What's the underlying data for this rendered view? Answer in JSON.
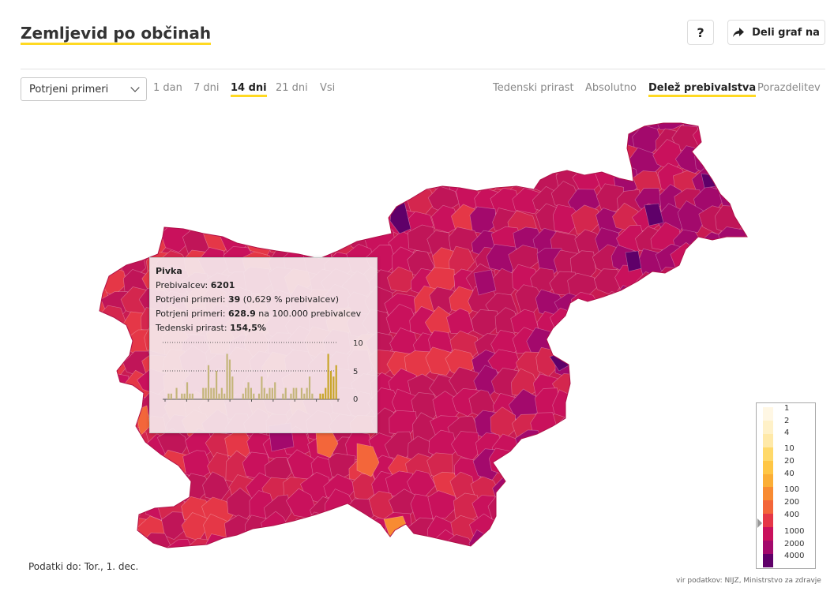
{
  "header": {
    "title": "Zemljevid po občinah",
    "help_label": "?",
    "share_label": "Deli graf na",
    "share_icon": "share-arrow-icon"
  },
  "controls": {
    "selected_measure": "Potrjeni primeri",
    "periods": [
      "1 dan",
      "7 dni",
      "14 dni",
      "21 dni",
      "Vsi"
    ],
    "active_period": "14 dni",
    "views": [
      "Tedenski prirast",
      "Absolutno",
      "Delež prebivalstva",
      "Porazdelitev"
    ],
    "active_view": "Delež prebivalstva"
  },
  "tooltip": {
    "municipality": "Pivka",
    "population_label": "Prebivalcev:",
    "population": "6201",
    "cases_label": "Potrjeni primeri:",
    "cases": "39",
    "cases_pct": "(0,629 % prebivalcev)",
    "per100k_label": "Potrjeni primeri:",
    "per100k": "628.9",
    "per100k_suffix": "na 100.000 prebivalcev",
    "growth_label": "Tedenski prirast:",
    "growth": "154,5%",
    "chart_ticks": [
      "10",
      "5",
      "0"
    ],
    "daily_cases": [
      0,
      1,
      1,
      0,
      2,
      0,
      1,
      1,
      3,
      1,
      1,
      0,
      0,
      0,
      2,
      2,
      6,
      2,
      2,
      5,
      1,
      2,
      1,
      8,
      7,
      4,
      0,
      0,
      0,
      1,
      2,
      3,
      2,
      1,
      0,
      1,
      4,
      2,
      1,
      2,
      2,
      3,
      0,
      0,
      1,
      2,
      0,
      1,
      2,
      2,
      0,
      2,
      1,
      2,
      4,
      1,
      0,
      0,
      1,
      1,
      2,
      8,
      5,
      4,
      6
    ]
  },
  "chart_data": {
    "type": "choropleth",
    "region": "Slovenija",
    "legend": {
      "stops": [
        "1",
        "2",
        "4",
        "10",
        "20",
        "40",
        "100",
        "200",
        "400",
        "1000",
        "2000",
        "4000"
      ],
      "colors": [
        "#fff7e4",
        "#fff1c8",
        "#ffe9a8",
        "#ffd96a",
        "#ffc645",
        "#fbae36",
        "#f88b32",
        "#f3663a",
        "#e53747",
        "#c9115c",
        "#a3096c",
        "#5f0069"
      ]
    }
  },
  "footer": {
    "data_until": "Podatki do: Tor., 1. dec.",
    "source": "vir podatkov: NIJZ, Ministrstvo za zdravje"
  }
}
